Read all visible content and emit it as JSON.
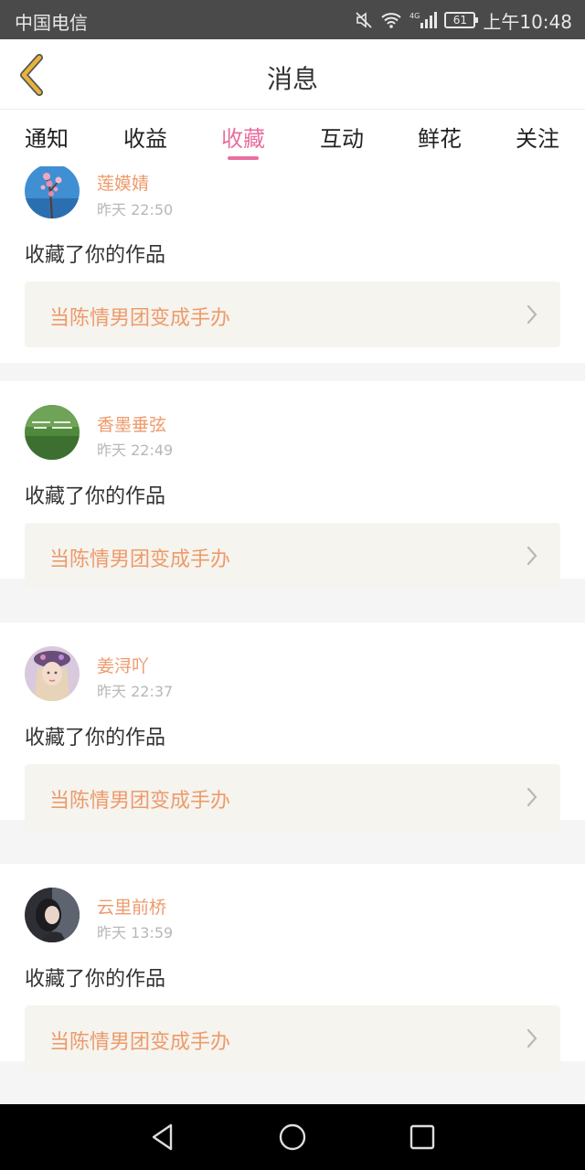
{
  "status_bar": {
    "carrier": "中国电信",
    "network": "4G",
    "battery": "61",
    "time": "上午10:48"
  },
  "header": {
    "title": "消息",
    "back_icon": "chevron-left-icon",
    "back_color": "#e7b43a"
  },
  "tabs": [
    {
      "label": "通知",
      "active": false
    },
    {
      "label": "收益",
      "active": false
    },
    {
      "label": "收藏",
      "active": true
    },
    {
      "label": "互动",
      "active": false
    },
    {
      "label": "鲜花",
      "active": false
    },
    {
      "label": "关注",
      "active": false
    }
  ],
  "colors": {
    "accent": "#e96fa0",
    "username": "#ee9a6b",
    "work_bg": "#f5f4ee"
  },
  "notifications": [
    {
      "username": "莲嫫婧",
      "time": "昨天 22:50",
      "action": "收藏了你的作品",
      "work_title": "当陈情男团变成手办"
    },
    {
      "username": "香墨垂弦",
      "time": "昨天 22:49",
      "action": "收藏了你的作品",
      "work_title": "当陈情男团变成手办"
    },
    {
      "username": "姜浔吖",
      "time": "昨天 22:37",
      "action": "收藏了你的作品",
      "work_title": "当陈情男团变成手办"
    },
    {
      "username": "云里前桥",
      "time": "昨天 13:59",
      "action": "收藏了你的作品",
      "work_title": "当陈情男团变成手办"
    }
  ],
  "nav_bar": {
    "back": "back-triangle-icon",
    "home": "home-circle-icon",
    "recents": "recents-square-icon"
  }
}
